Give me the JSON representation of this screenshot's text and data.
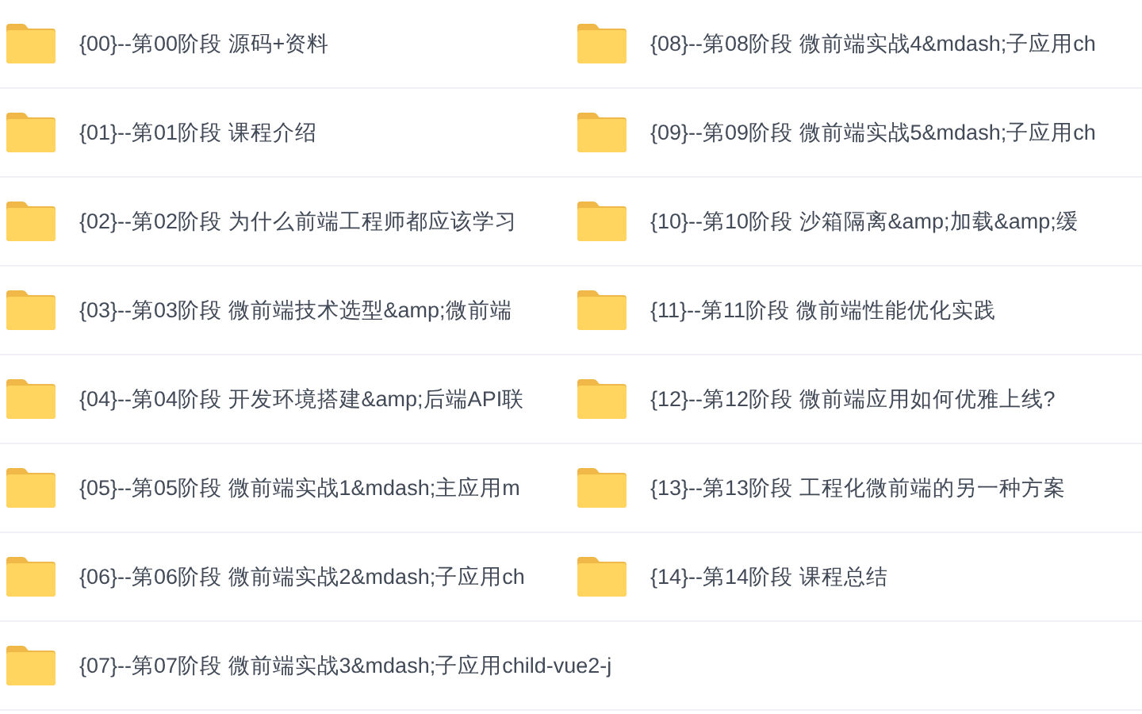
{
  "rows": [
    {
      "left": {
        "name": "{00}--第00阶段 源码+资料"
      },
      "right": {
        "name": "{08}--第08阶段 微前端实战4&mdash;子应用ch"
      }
    },
    {
      "left": {
        "name": "{01}--第01阶段 课程介绍"
      },
      "right": {
        "name": "{09}--第09阶段 微前端实战5&mdash;子应用ch"
      }
    },
    {
      "left": {
        "name": "{02}--第02阶段 为什么前端工程师都应该学习"
      },
      "right": {
        "name": "{10}--第10阶段 沙箱隔离&amp;加载&amp;缓"
      }
    },
    {
      "left": {
        "name": "{03}--第03阶段 微前端技术选型&amp;微前端"
      },
      "right": {
        "name": "{11}--第11阶段 微前端性能优化实践"
      }
    },
    {
      "left": {
        "name": "{04}--第04阶段 开发环境搭建&amp;后端API联"
      },
      "right": {
        "name": "{12}--第12阶段 微前端应用如何优雅上线?"
      }
    },
    {
      "left": {
        "name": "{05}--第05阶段 微前端实战1&mdash;主应用m"
      },
      "right": {
        "name": "{13}--第13阶段 工程化微前端的另一种方案"
      }
    },
    {
      "left": {
        "name": "{06}--第06阶段 微前端实战2&mdash;子应用ch"
      },
      "right": {
        "name": "{14}--第14阶段 课程总结"
      }
    },
    {
      "left": {
        "name": "{07}--第07阶段 微前端实战3&mdash;子应用child-vue2-j"
      }
    }
  ]
}
